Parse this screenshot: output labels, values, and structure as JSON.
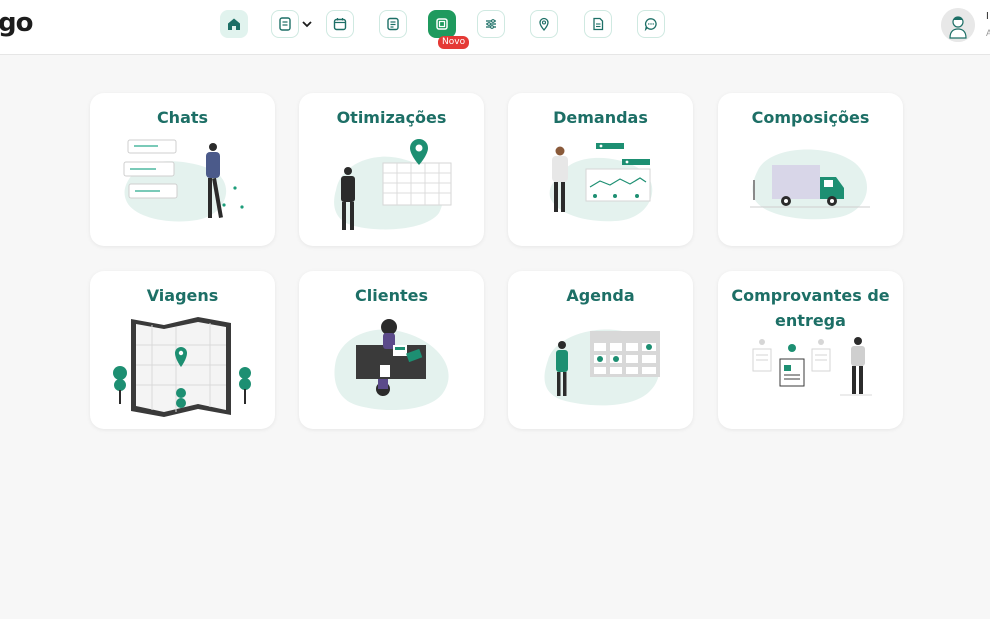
{
  "header": {
    "logo_text": "go",
    "badge_text": "Novo",
    "user": {
      "name": "I",
      "role": "A"
    }
  },
  "nav": {
    "icons": [
      "home-icon",
      "document-icon",
      "calendar-icon",
      "list-icon",
      "route-icon",
      "sliders-icon",
      "map-pin-icon",
      "file-icon",
      "chat-icon"
    ]
  },
  "cards": [
    {
      "title": "Chats"
    },
    {
      "title": "Otimizações"
    },
    {
      "title": "Demandas"
    },
    {
      "title": "Composições"
    },
    {
      "title": "Viagens"
    },
    {
      "title": "Clientes"
    },
    {
      "title": "Agenda"
    },
    {
      "title": "Comprovantes de entrega"
    }
  ],
  "colors": {
    "accent": "#1d6f66",
    "accent_light": "#e1f3ee",
    "new_badge": "#e53935",
    "new_icon": "#1f9a5e"
  }
}
